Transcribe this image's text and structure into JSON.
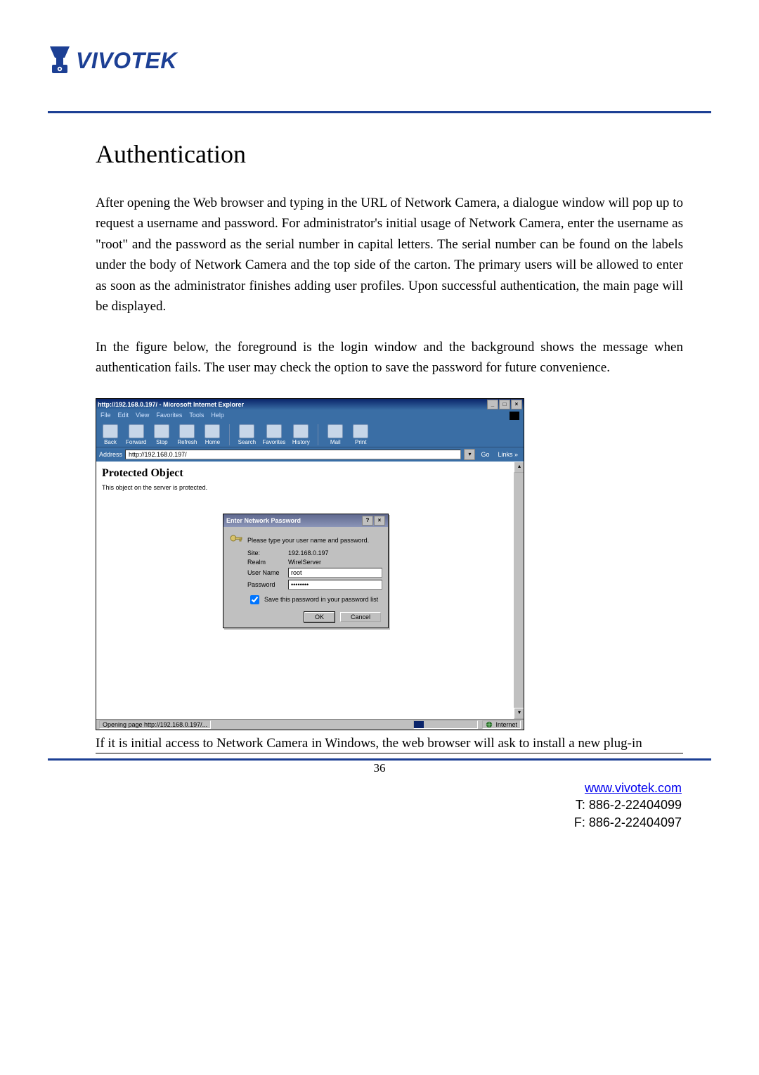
{
  "logo": {
    "text": "VIVOTEK"
  },
  "heading": "Authentication",
  "para1": "After opening the Web browser and typing in the URL of Network Camera, a dialogue window will pop up to request a username and password. For administrator's initial usage of Network Camera, enter the username as \"root\" and the password as the serial number in capital letters. The serial number can be found on the labels under the body of Network Camera and the top side of the carton. The primary users will be allowed to enter as soon as the administrator finishes adding user profiles. Upon successful authentication, the main page will be displayed.",
  "para2": "In the figure below, the foreground is the login window and the background shows the message when authentication fails. The user may check the option to save the password for future convenience.",
  "ie": {
    "title": "http://192.168.0.197/ - Microsoft Internet Explorer",
    "menus": [
      "File",
      "Edit",
      "View",
      "Favorites",
      "Tools",
      "Help"
    ],
    "toolbar": [
      "Back",
      "Forward",
      "Stop",
      "Refresh",
      "Home",
      "Search",
      "Favorites",
      "History",
      "Mail",
      "Print"
    ],
    "address_label": "Address",
    "address_value": "http://192.168.0.197/",
    "go": "Go",
    "links": "Links »",
    "page_heading": "Protected Object",
    "page_sub": "This object on the server is protected.",
    "status_left": "Opening page http://192.168.0.197/...",
    "status_right": "Internet"
  },
  "dialog": {
    "title": "Enter Network Password",
    "prompt": "Please type your user name and password.",
    "site_label": "Site:",
    "site_value": "192.168.0.197",
    "realm_label": "Realm",
    "realm_value": "WirelServer",
    "user_label": "User Name",
    "user_value": "root",
    "pass_label": "Password",
    "pass_value": "••••••••",
    "save_label": "Save this password in your password list",
    "ok": "OK",
    "cancel": "Cancel"
  },
  "tail": "If it is initial access to Network Camera in Windows, the web browser will ask to install a new plug-in",
  "page_number": "36",
  "footer": {
    "url": "www.vivotek.com",
    "tel": "T: 886-2-22404099",
    "fax": "F: 886-2-22404097"
  }
}
